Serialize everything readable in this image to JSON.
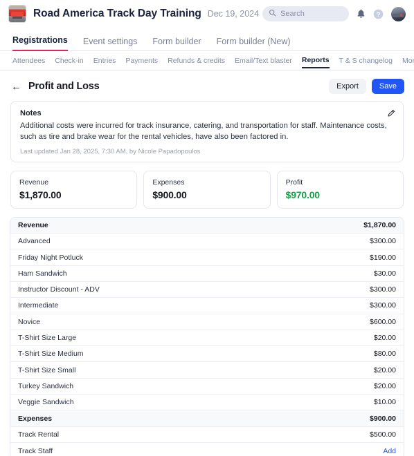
{
  "topbar": {
    "logo_icon": "event-logo-car-thumbnail",
    "title": "Road America Track Day Training",
    "date": "Dec 19, 2024",
    "search": {
      "placeholder": "Search",
      "icon": "search-icon"
    },
    "notifications_icon": "bell-icon",
    "help_icon": "help-circle-icon",
    "avatar_icon": "user-avatar"
  },
  "primary_tabs": [
    {
      "label": "Registrations",
      "active": true
    },
    {
      "label": "Event settings",
      "active": false
    },
    {
      "label": "Form builder",
      "active": false
    },
    {
      "label": "Form builder (New)",
      "active": false
    }
  ],
  "secondary_tabs": [
    {
      "label": "Attendees",
      "active": false
    },
    {
      "label": "Check-in",
      "active": false
    },
    {
      "label": "Entries",
      "active": false
    },
    {
      "label": "Payments",
      "active": false
    },
    {
      "label": "Refunds & credits",
      "active": false
    },
    {
      "label": "Email/Text blaster",
      "active": false
    },
    {
      "label": "Reports",
      "active": true
    },
    {
      "label": "T & S changelog",
      "active": false
    },
    {
      "label": "More",
      "active": false,
      "has_caret": true
    }
  ],
  "page": {
    "back_icon": "back-arrow-icon",
    "title": "Profit and Loss",
    "export_label": "Export",
    "save_label": "Save"
  },
  "notes": {
    "heading": "Notes",
    "body": "Additional costs were incurred for track insurance, catering, and transportation for staff. Maintenance costs, such as tire and brake wear for the rental vehicles, have also been factored in.",
    "meta": "Last updated Jan 28, 2025, 7:30 AM, by Nicole Papadopoulos",
    "edit_icon": "pencil-icon"
  },
  "stats": [
    {
      "label": "Revenue",
      "value": "$1,870.00",
      "positive": false
    },
    {
      "label": "Expenses",
      "value": "$900.00",
      "positive": false
    },
    {
      "label": "Profit",
      "value": "$970.00",
      "positive": true
    }
  ],
  "table": {
    "rows": [
      {
        "label": "Revenue",
        "amount": "$1,870.00",
        "section": true
      },
      {
        "label": "Advanced",
        "amount": "$300.00",
        "section": false
      },
      {
        "label": "Friday Night Potluck",
        "amount": "$190.00",
        "section": false
      },
      {
        "label": "Ham Sandwich",
        "amount": "$30.00",
        "section": false
      },
      {
        "label": "Instructor Discount - ADV",
        "amount": "$300.00",
        "section": false
      },
      {
        "label": "Intermediate",
        "amount": "$300.00",
        "section": false
      },
      {
        "label": "Novice",
        "amount": "$600.00",
        "section": false
      },
      {
        "label": "T-Shirt Size Large",
        "amount": "$20.00",
        "section": false
      },
      {
        "label": "T-Shirt Size Medium",
        "amount": "$80.00",
        "section": false
      },
      {
        "label": "T-Shirt Size Small",
        "amount": "$20.00",
        "section": false
      },
      {
        "label": "Turkey Sandwich",
        "amount": "$20.00",
        "section": false
      },
      {
        "label": "Veggie Sandwich",
        "amount": "$10.00",
        "section": false
      },
      {
        "label": "Expenses",
        "amount": "$900.00",
        "section": true
      },
      {
        "label": "Track Rental",
        "amount": "$500.00",
        "section": false
      },
      {
        "label": "Track Staff",
        "amount": "Add",
        "section": false,
        "is_link": true
      }
    ]
  },
  "colors": {
    "brand_accent": "#e8235a",
    "primary_button": "#1f56f5",
    "link": "#1f56f5",
    "positive": "#1a9e4b",
    "title_navy": "#1a2340"
  }
}
